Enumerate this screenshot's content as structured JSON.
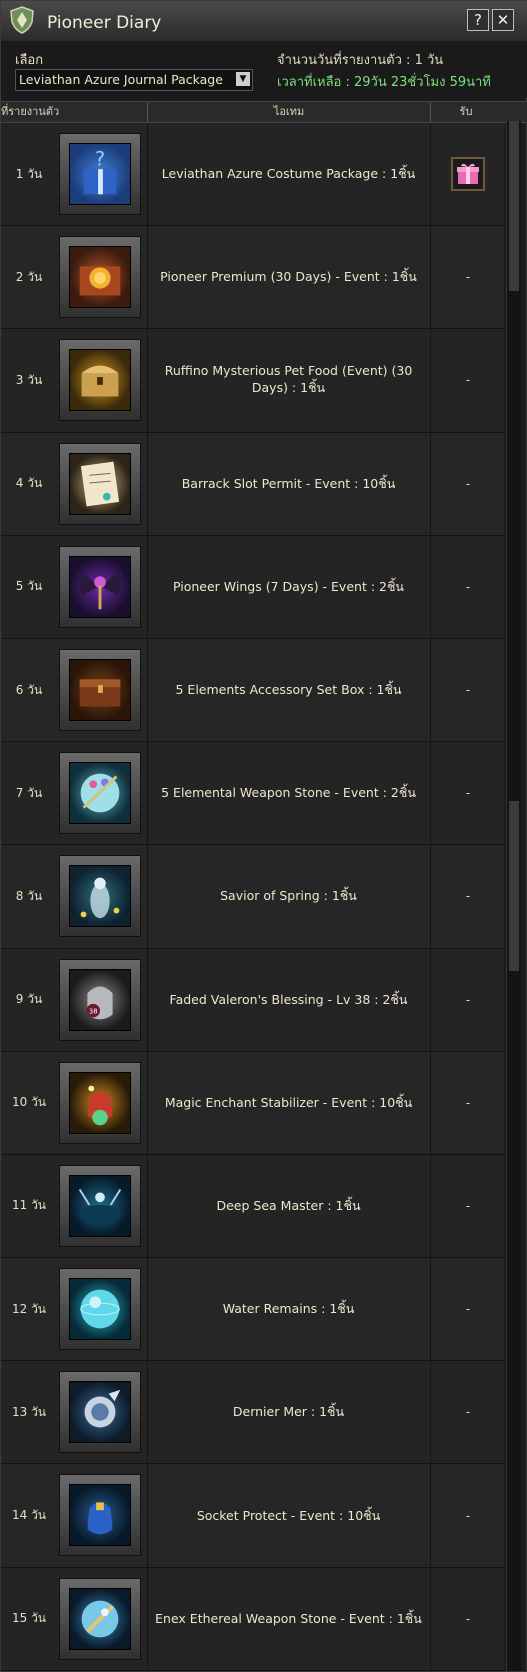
{
  "window": {
    "title": "Pioneer Diary",
    "help_label": "?",
    "close_label": "✕"
  },
  "toolbar": {
    "select_label": "เลือก",
    "package_value": "Leviathan Azure Journal Package",
    "days_info": "จำนวนวันที่รายงานตัว : 1 วัน",
    "time_left": "เวลาที่เหลือ : 29วัน 23ชั่วโมง 59นาที"
  },
  "table": {
    "headers": {
      "day": "ที่รายงานตัว",
      "item": "ไอเทม",
      "claim": "รับ"
    },
    "rows": [
      {
        "day": "1 วัน",
        "item": "Leviathan Azure Costume Package : 1ชิ้น",
        "claim": "",
        "icon": "gift-box-icon"
      },
      {
        "day": "2 วัน",
        "item": "Pioneer Premium (30 Days) - Event : 1ชิ้น",
        "claim": "-",
        "icon": "treasure-chest-coin-icon"
      },
      {
        "day": "3 วัน",
        "item": "Ruffino Mysterious Pet Food (Event) (30 Days) : 1ชิ้น",
        "claim": "-",
        "icon": "golden-chest-icon"
      },
      {
        "day": "4 วัน",
        "item": "Barrack Slot Permit - Event : 10ชิ้น",
        "claim": "-",
        "icon": "permit-scroll-icon"
      },
      {
        "day": "5 วัน",
        "item": "Pioneer Wings (7 Days) - Event : 2ชิ้น",
        "claim": "-",
        "icon": "dark-wings-icon"
      },
      {
        "day": "6 วัน",
        "item": "5 Elements Accessory Set Box : 1ชิ้น",
        "claim": "-",
        "icon": "wooden-box-icon"
      },
      {
        "day": "7 วัน",
        "item": "5 Elemental Weapon Stone - Event : 2ชิ้น",
        "claim": "-",
        "icon": "crystal-orb-icon"
      },
      {
        "day": "8 วัน",
        "item": "Savior of Spring : 1ชิ้น",
        "claim": "-",
        "icon": "spring-spirit-icon"
      },
      {
        "day": "9 วัน",
        "item": "Faded Valeron's Blessing - Lv 38 : 2ชิ้น",
        "claim": "-",
        "icon": "blessing-pouch-icon"
      },
      {
        "day": "10 วัน",
        "item": "Magic Enchant Stabilizer - Event : 10ชิ้น",
        "claim": "-",
        "icon": "magic-pouch-icon"
      },
      {
        "day": "11 วัน",
        "item": "Deep Sea Master : 1ชิ้น",
        "claim": "-",
        "icon": "deep-sea-icon"
      },
      {
        "day": "12 วัน",
        "item": "Water Remains : 1ชิ้น",
        "claim": "-",
        "icon": "water-orb-icon"
      },
      {
        "day": "13 วัน",
        "item": "Dernier Mer : 1ชิ้น",
        "claim": "-",
        "icon": "shell-crest-icon"
      },
      {
        "day": "14 วัน",
        "item": "Socket Protect - Event : 10ชิ้น",
        "claim": "-",
        "icon": "socket-pouch-icon"
      },
      {
        "day": "15 วัน",
        "item": "Enex Ethereal Weapon Stone - Event : 1ชิ้น",
        "claim": "-",
        "icon": "ethereal-stone-icon"
      }
    ]
  },
  "colors": {
    "accent_green": "#7de07a",
    "text": "#efe7cd",
    "panel": "#242424"
  }
}
